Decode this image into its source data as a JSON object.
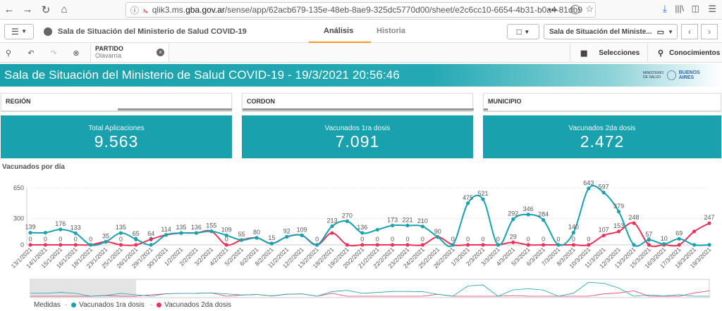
{
  "browser": {
    "url_prefix": "qlik3.ms.",
    "url_host": "gba.gov.ar",
    "url_path": "/sense/app/62acb679-135e-48eb-8ae9-325dc5770d00/sheet/e2c6cc10-6654-4b31-b0a4-81db9",
    "url_more": "•••"
  },
  "app": {
    "title": "Sala de Situación del Ministerio de Salud COVID-19",
    "tabs": [
      {
        "label": "Análisis"
      },
      {
        "label": "Historia"
      }
    ],
    "sheet_selector": "Sala de Situación del Ministe...",
    "selecciones_label": "Selecciones",
    "conocimientos_label": "Conocimientos"
  },
  "filter_chip": {
    "field": "PARTIDO",
    "value": "Olavarría"
  },
  "banner": {
    "title": "Sala de Situación del Ministerio de Salud COVID-19 - 19/3/2021 20:56:46",
    "logo_ministerio": "MINISTERIO DE SALUD",
    "logo_ba": "BUENOS AIRES"
  },
  "filters": [
    {
      "label": "REGIÓN"
    },
    {
      "label": "CORDON"
    },
    {
      "label": "MUNICIPIO"
    }
  ],
  "kpis": [
    {
      "label": "Total Aplicaciones",
      "value": "9.563"
    },
    {
      "label": "Vacunados 1ra dosis",
      "value": "7.091"
    },
    {
      "label": "Vacunados 2da dosis",
      "value": "2.472"
    }
  ],
  "chart_title": "Vacunados por día",
  "legend": {
    "title": "Medidas"
  },
  "colors": {
    "teal": "#19a2ad",
    "pink": "#e8345b",
    "accent": "#f8981d"
  },
  "chart_data": {
    "type": "line",
    "x": [
      "13/1/2021",
      "14/1/2021",
      "15/1/2021",
      "16/1/2021",
      "18/1/2021",
      "23/1/2021",
      "25/1/2021",
      "26/1/2021",
      "29/1/2021",
      "30/1/2021",
      "1/2/2021",
      "2/2/2021",
      "3/2/2021",
      "4/2/2021",
      "5/2/2021",
      "6/2/2021",
      "8/2/2021",
      "11/2/2021",
      "12/2/2021",
      "13/2/2021",
      "18/2/2021",
      "19/2/2021",
      "20/2/2021",
      "21/2/2021",
      "22/2/2021",
      "23/2/2021",
      "24/2/2021",
      "25/2/2021",
      "26/2/2021",
      "1/3/2021",
      "2/3/2021",
      "3/3/2021",
      "4/3/2021",
      "5/3/2021",
      "6/3/2021",
      "7/3/2021",
      "8/3/2021",
      "10/3/2021",
      "11/3/2021",
      "12/3/2021",
      "13/3/2021",
      "15/3/2021",
      "16/3/2021",
      "17/3/2021",
      "18/3/2021",
      "19/3/2021"
    ],
    "ylim": [
      0,
      650
    ],
    "yticks": [
      "0",
      "300",
      "650"
    ],
    "series": [
      {
        "name": "Vacunados 1ra dosis",
        "color": "#19a2ad",
        "values": [
          139,
          139,
          176,
          133,
          0,
          35,
          135,
          65,
          0,
          114,
          135,
          136,
          155,
          109,
          55,
          80,
          15,
          92,
          109,
          0,
          213,
          270,
          136,
          173,
          221,
          221,
          210,
          90,
          0,
          475,
          521,
          0,
          292,
          346,
          284,
          0,
          140,
          643,
          597,
          379,
          0,
          57,
          10,
          69,
          0,
          0
        ],
        "labels": [
          "139",
          "",
          "176",
          "133",
          "0",
          "35",
          "135",
          "65",
          "0",
          "114",
          "135",
          "136",
          "155",
          "109",
          "55",
          "80",
          "15",
          "92",
          "109",
          "0",
          "213",
          "270",
          "136",
          "",
          "173",
          "221",
          "210",
          "90",
          "",
          "475",
          "521",
          "",
          "292",
          "346",
          "284",
          "",
          "140",
          "643",
          "597",
          "379",
          "",
          "57",
          "10",
          "69",
          "",
          ""
        ]
      },
      {
        "name": "Vacunados 2da dosis",
        "color": "#e8345b",
        "values": [
          0,
          0,
          0,
          0,
          0,
          35,
          0,
          0,
          64,
          114,
          135,
          136,
          155,
          0,
          55,
          80,
          15,
          92,
          109,
          0,
          135,
          0,
          0,
          0,
          0,
          0,
          0,
          90,
          0,
          0,
          0,
          0,
          29,
          0,
          0,
          0,
          0,
          0,
          107,
          153,
          248,
          0,
          0,
          0,
          153,
          247
        ],
        "labels": [
          "0",
          "0",
          "0",
          "0",
          "",
          "",
          "0",
          "0",
          "64",
          "",
          "",
          "",
          "",
          "0",
          "",
          "",
          "",
          "",
          "",
          "",
          "",
          "",
          "0",
          "0",
          "0",
          "0",
          "0",
          "",
          "0",
          "0",
          "0",
          "0",
          "29",
          "0",
          "0",
          "0",
          "0",
          "0",
          "107",
          "153",
          "248",
          "0",
          "",
          "",
          "",
          "247"
        ]
      }
    ]
  }
}
